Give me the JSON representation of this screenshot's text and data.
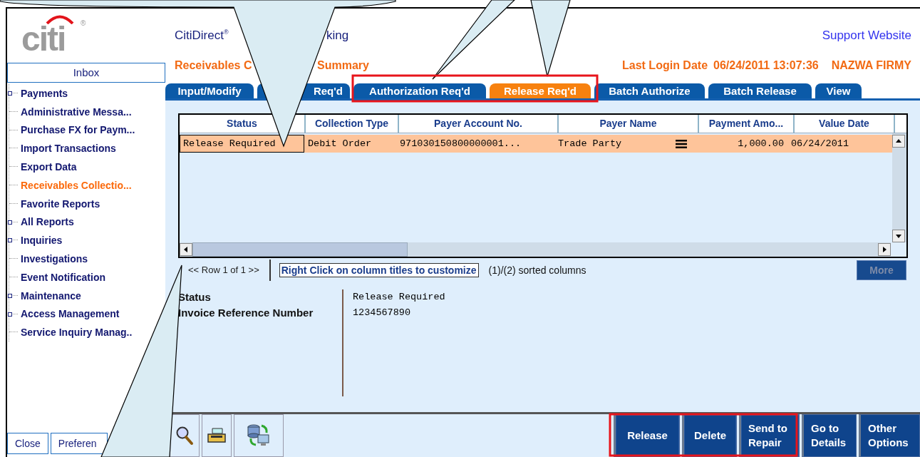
{
  "logo": {
    "text": "citi",
    "mark": "®"
  },
  "sidebar": {
    "inbox": "Inbox",
    "items": [
      {
        "label": "Payments",
        "expandable": true,
        "selected": false
      },
      {
        "label": "Administrative Messa...",
        "expandable": false,
        "selected": false
      },
      {
        "label": "Purchase FX for Paym...",
        "expandable": false,
        "selected": false
      },
      {
        "label": "Import Transactions",
        "expandable": false,
        "selected": false
      },
      {
        "label": "Export Data",
        "expandable": false,
        "selected": false
      },
      {
        "label": "Receivables Collectio...",
        "expandable": false,
        "selected": true
      },
      {
        "label": "Favorite Reports",
        "expandable": false,
        "selected": false
      },
      {
        "label": "All Reports",
        "expandable": true,
        "selected": false
      },
      {
        "label": "Inquiries",
        "expandable": true,
        "selected": false
      },
      {
        "label": "Investigations",
        "expandable": false,
        "selected": false
      },
      {
        "label": "Event Notification",
        "expandable": false,
        "selected": false
      },
      {
        "label": "Maintenance",
        "expandable": true,
        "selected": false
      },
      {
        "label": "Access Management",
        "expandable": true,
        "selected": false
      },
      {
        "label": "Service Inquiry Manag..",
        "expandable": false,
        "selected": false
      }
    ],
    "buttons": [
      "Close",
      "Preferen"
    ]
  },
  "header": {
    "title_parts": [
      "CitiDirect$^{®}$",
      "king"
    ],
    "support_link": "Support Website",
    "page_title_parts": [
      "Receivables C",
      "Summary"
    ],
    "last_login_label": "Last Login Date",
    "last_login": "06/24/2011 13:07:36",
    "company": "NAZWA FIRMY"
  },
  "tabs": [
    {
      "label": "Input/Modify",
      "selected": false
    },
    {
      "label": "Req'd",
      "selected": false
    },
    {
      "label": "Authorization Req'd",
      "selected": false
    },
    {
      "label": "Release Req'd",
      "selected": true
    },
    {
      "label": "Batch Authorize",
      "selected": false
    },
    {
      "label": "Batch Release",
      "selected": false
    },
    {
      "label": "View",
      "selected": false
    }
  ],
  "table": {
    "columns": [
      "Status",
      "Collection Type",
      "Payer Account No.",
      "Payer Name",
      "Payment Amo...",
      "Value Date"
    ],
    "rows": [
      {
        "selected": true,
        "cells": [
          {
            "text": "Release Required",
            "focused": true
          },
          {
            "text": "Debit Order",
            "focused": false
          },
          {
            "text": "971030150800000001...",
            "focused": false
          },
          {
            "text": "Trade Party",
            "focused": false
          },
          {
            "text": "1,000.00",
            "focused": false
          },
          {
            "text": "06/24/2011",
            "focused": false
          }
        ]
      }
    ]
  },
  "pager": {
    "rows": "<< Row 1 of 1 >>",
    "hint": "Right Click on column titles to customize",
    "sorted": "(1)/(2) sorted columns",
    "more": {
      "label": "More",
      "disabled": true
    }
  },
  "details": [
    {
      "label": "Status",
      "value": "Release Required"
    },
    {
      "label": "Invoice Reference Number",
      "value": "1234567890"
    }
  ],
  "toolbar": {
    "actions": [
      {
        "label": "Release",
        "highlighted": true
      },
      {
        "label": "Delete",
        "highlighted": true
      },
      {
        "label": "Send to Repair",
        "highlighted": true
      },
      {
        "label": "Go to Details",
        "highlighted": false
      },
      {
        "label": "Other Options",
        "highlighted": false
      }
    ]
  }
}
